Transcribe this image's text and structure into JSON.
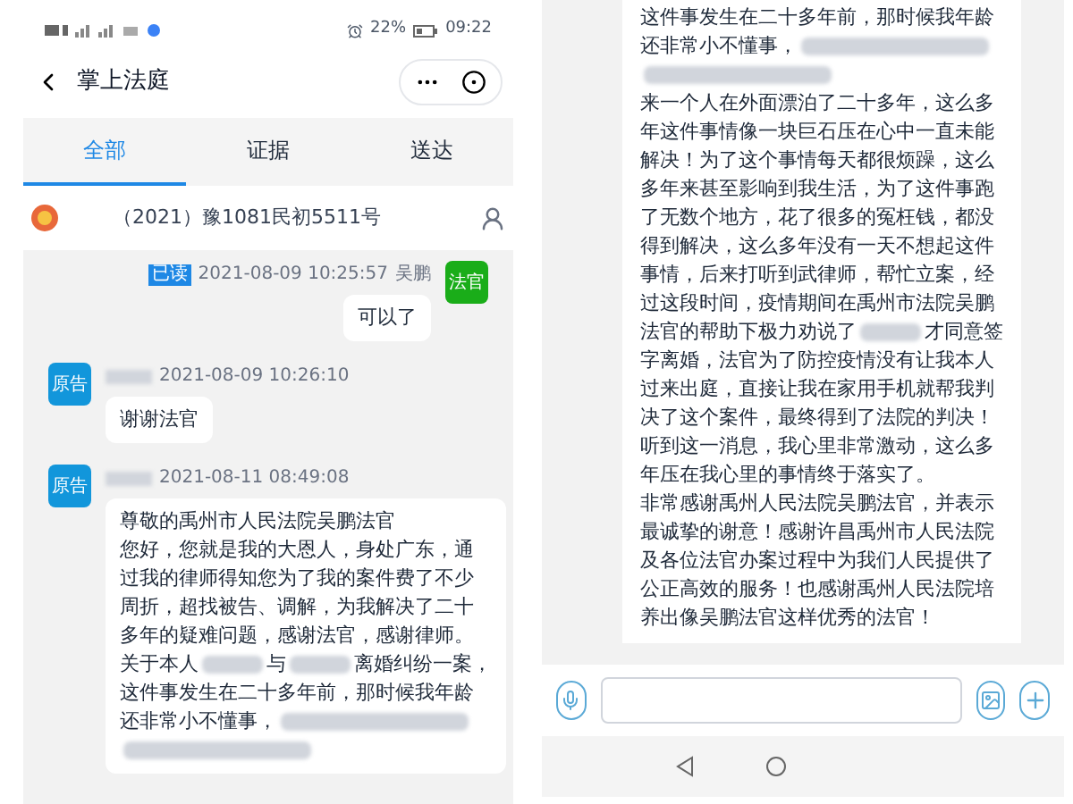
{
  "left_screen": {
    "status_bar": {
      "battery": "22%",
      "time": "09:22"
    },
    "header": {
      "title": "掌上法庭"
    },
    "tabs": [
      {
        "label": "全部",
        "selected": true
      },
      {
        "label": "证据",
        "selected": false
      },
      {
        "label": "送达",
        "selected": false
      }
    ],
    "case": {
      "number": "（2021）豫1081民初5511号"
    },
    "messages": [
      {
        "kind": "outgoing",
        "role": "法官",
        "color": "#1aad19",
        "read_badge": "已读",
        "time": "2021-08-09 10:25:57",
        "name": "吴鹏",
        "lines": [
          [
            {
              "kind": "text",
              "text": "可以了"
            }
          ]
        ]
      },
      {
        "kind": "incoming",
        "role": "原告",
        "color": "#1296db",
        "time": "2021-08-09 10:26:10",
        "lines": [
          [
            {
              "kind": "text",
              "text": "谢谢法官"
            }
          ]
        ]
      },
      {
        "kind": "incoming",
        "role": "原告",
        "color": "#1296db",
        "time": "2021-08-11 08:49:08",
        "lines": [
          [
            {
              "kind": "text",
              "text": "尊敬的禹州市人民法院吴鹏法官"
            }
          ],
          [
            {
              "kind": "text",
              "text": "您好，您就是我的大恩人，身处广东，通"
            }
          ],
          [
            {
              "kind": "text",
              "text": "过我的律师得知您为了我的案件费了不少"
            }
          ],
          [
            {
              "kind": "text",
              "text": "周折，超找被告、调解，为我解决了二十"
            }
          ],
          [
            {
              "kind": "text",
              "text": "多年的疑难问题，感谢法官，感谢律师。"
            }
          ],
          [
            {
              "kind": "text",
              "text": "关于本人"
            },
            {
              "kind": "blur"
            },
            {
              "kind": "text",
              "text": "与"
            },
            {
              "kind": "blur"
            },
            {
              "kind": "text",
              "text": "离婚纠纷一案，"
            }
          ],
          [
            {
              "kind": "text",
              "text": "这件事发生在二十多年前，那时候我年龄"
            }
          ],
          [
            {
              "kind": "text",
              "text": "还非常小不懂事，"
            },
            {
              "kind": "blur_long"
            }
          ],
          [
            {
              "kind": "blur_long"
            }
          ]
        ]
      }
    ]
  },
  "right_screen": {
    "message_lines": [
      [
        {
          "kind": "text",
          "text": "这件事发生在二十多年前，那时候我年龄"
        }
      ],
      [
        {
          "kind": "text",
          "text": "还非常小不懂事，"
        },
        {
          "kind": "blur_long"
        }
      ],
      [
        {
          "kind": "blur_long"
        }
      ],
      [
        {
          "kind": "text",
          "text": "来一个人在外面漂泊了二十多年，这么多"
        }
      ],
      [
        {
          "kind": "text",
          "text": "年这件事情像一块巨石压在心中一直未能"
        }
      ],
      [
        {
          "kind": "text",
          "text": "解决！为了这个事情每天都很烦躁，这么"
        }
      ],
      [
        {
          "kind": "text",
          "text": "多年来甚至影响到我生活，为了这件事跑"
        }
      ],
      [
        {
          "kind": "text",
          "text": "了无数个地方，花了很多的冤枉钱，都没"
        }
      ],
      [
        {
          "kind": "text",
          "text": "得到解决，这么多年没有一天不想起这件"
        }
      ],
      [
        {
          "kind": "text",
          "text": "事情，后来打听到武律师，帮忙立案，经"
        }
      ],
      [
        {
          "kind": "text",
          "text": "过这段时间，疫情期间在禹州市法院吴鹏"
        }
      ],
      [
        {
          "kind": "text",
          "text": "法官的帮助下极力劝说了"
        },
        {
          "kind": "blur"
        },
        {
          "kind": "text",
          "text": "才同意签"
        }
      ],
      [
        {
          "kind": "text",
          "text": "字离婚，法官为了防控疫情没有让我本人"
        }
      ],
      [
        {
          "kind": "text",
          "text": "过来出庭，直接让我在家用手机就帮我判"
        }
      ],
      [
        {
          "kind": "text",
          "text": "决了这个案件，最终得到了法院的判决！"
        }
      ],
      [
        {
          "kind": "text",
          "text": "听到这一消息，我心里非常激动，这么多"
        }
      ],
      [
        {
          "kind": "text",
          "text": "年压在我心里的事情终于落实了。"
        }
      ],
      [
        {
          "kind": "text",
          "text": "非常感谢禹州人民法院吴鹏法官，并表示"
        }
      ],
      [
        {
          "kind": "text",
          "text": "最诚挚的谢意！感谢许昌禹州市人民法院"
        }
      ],
      [
        {
          "kind": "text",
          "text": "及各位法官办案过程中为我们人民提供了"
        }
      ],
      [
        {
          "kind": "text",
          "text": "公正高效的服务！也感谢禹州人民法院培"
        }
      ],
      [
        {
          "kind": "text",
          "text": "养出像吴鹏法官这样优秀的法官！"
        }
      ]
    ]
  }
}
